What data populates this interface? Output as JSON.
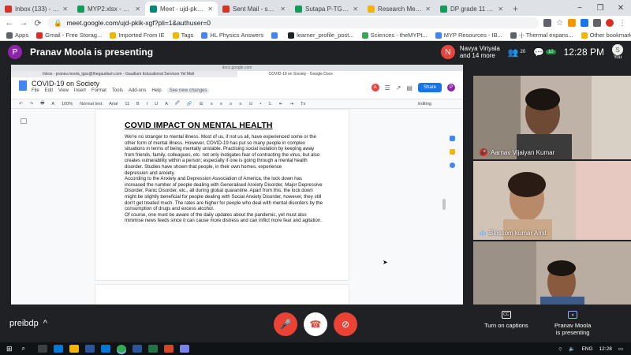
{
  "browser": {
    "tabs": [
      {
        "label": "Inbox (133) - sutapa.pa...",
        "icon_color": "#d93025",
        "active": false
      },
      {
        "label": "MYP2.xlsx - Google She...",
        "icon_color": "#0f9d58",
        "active": false
      },
      {
        "label": "Meet - ujd-pkik-w...",
        "icon_color": "#00897b",
        "active": true
      },
      {
        "label": "Sent Mail - sutapa.pa...",
        "icon_color": "#d93025",
        "active": false
      },
      {
        "label": "Sutapa P-TGS-TP 2020...",
        "icon_color": "#0f9d58",
        "active": false
      },
      {
        "label": "Research Methodolog...",
        "icon_color": "#f4b400",
        "active": false
      },
      {
        "label": "DP grade 11 students...",
        "icon_color": "#0f9d58",
        "active": false
      }
    ],
    "new_tab": "+",
    "window_controls": [
      "−",
      "❐",
      "✕"
    ],
    "url": "meet.google.com/ujd-pkik-xgf?pli=1&authuser=0",
    "bookmarks": [
      {
        "label": "Apps",
        "color": "#5f6368"
      },
      {
        "label": "Gmail - Free Storag...",
        "color": "#d93025"
      },
      {
        "label": "Imported From IE",
        "color": "#f4b400"
      },
      {
        "label": "Tags",
        "color": "#f4b400"
      },
      {
        "label": "HL Physics Answers",
        "color": "#4285f4"
      },
      {
        "label": "",
        "color": "#4285f4"
      },
      {
        "label": "learner_profile_post...",
        "color": "#202124"
      },
      {
        "label": "Sciences - theMYPt...",
        "color": "#34a853"
      },
      {
        "label": "MYP Resources - IB...",
        "color": "#4285f4"
      },
      {
        "label": "-|- Thermal expans...",
        "color": "#5f6368"
      }
    ],
    "other_bookmarks": "Other bookmarks"
  },
  "meet": {
    "presenter_initial": "P",
    "presenter_color": "#8e24aa",
    "presenting_text": "Pranav Moola is presenting",
    "presenter_chip_initial": "N",
    "presenter_chip_color": "#e8453c",
    "presenter_chip_line1": "Navya Viriyala",
    "presenter_chip_line2": "and 14 more",
    "people_count": "20",
    "chat_count": "10",
    "time": "12:28 PM",
    "you_label": "You",
    "you_initial": "S",
    "meeting_code": "preibdp",
    "chevron": "^",
    "captions_label": "Turn on captions",
    "captions_icon": "CC",
    "presenting_label_line1": "Pranav Moola",
    "presenting_label_line2": "is presenting",
    "participants": [
      {
        "name": "Aarnav Vijaiyan Kumar",
        "muted": true,
        "bg": "#b7a79a"
      },
      {
        "name": "Blossom kumar Amit",
        "muted": false,
        "bg": "#c7b6a6"
      },
      {
        "name": "",
        "muted": false,
        "bg": "#b3a89f"
      }
    ]
  },
  "shared_doc": {
    "browser_title": "docs.google.com",
    "tab_left": "Inbox - pranav.moola_tgss@thegaudium.com - Gaudium Educational Services Yel Mail",
    "tab_right": "COVID-19 on Society - Google Docs",
    "title": "COVID-19 on Society",
    "star": "☆",
    "menus": [
      "File",
      "Edit",
      "View",
      "Insert",
      "Format",
      "Tools",
      "Add-ons",
      "Help"
    ],
    "see_changes": "See new changes",
    "collab_initials": [
      "A",
      "P"
    ],
    "collab_colors": [
      "#e8453c",
      "#8e24aa"
    ],
    "share_label": "Share",
    "toolbar": [
      "↶",
      "↷",
      "🖶",
      "A",
      "100%",
      "Normal text",
      "Arial",
      "11",
      "B",
      "I",
      "U",
      "A",
      "🖉",
      "🔗",
      "☰",
      "≡",
      "≡",
      "≡",
      "≡",
      "☷",
      "•",
      "1.",
      "⇤",
      "⇥",
      "Tx"
    ],
    "editing_label": "Editing",
    "heading": "COVID IMPACT ON MENTAL HEALTH",
    "body_lines": [
      "We're no stranger to mental illness. Most of us, if not us all, have experienced some or the",
      "other form of mental illness. However, COVID-19 has put so many people in complex",
      "situations in terms of being mentally unstable. Practising social isolation by keeping away",
      "from friends, family, colleagues, etc. not only instigates fear of contracting the virus, but also",
      "creates vulnerability within a person; especially if one is going through a mental health",
      "disorder. Studies have shown that people, in their own homes, experience",
      "depression and anxiety.",
      "According to the Anxiety and Depression Association of America, the lock down has",
      "increased the number of people dealing with Generalised Anxiety Disorder, Major Depressive",
      "Disorder, Panic Disorder, etc., all during global quarantine. Apart from this, the lock down",
      "might be slightly beneficial for people dealing with Social Anxiety Disorder, however, they still",
      "don't get treated much. The rates are higher for people who deal with mental disorders by the",
      "consumption of drugs and excess alcohol.",
      "Of course, one must be aware of the daily updates about the pandemic, yet must also",
      "minimise news feeds since it can cause more distress and can inflict more fear and agitation."
    ]
  },
  "taskbar": {
    "lang": "ENG",
    "time": "12:28"
  },
  "colors": {
    "meet_bg": "#202124",
    "mute_red": "#ea4335",
    "hangup_bg": "#ffffff",
    "accent_blue": "#1a73e8"
  }
}
